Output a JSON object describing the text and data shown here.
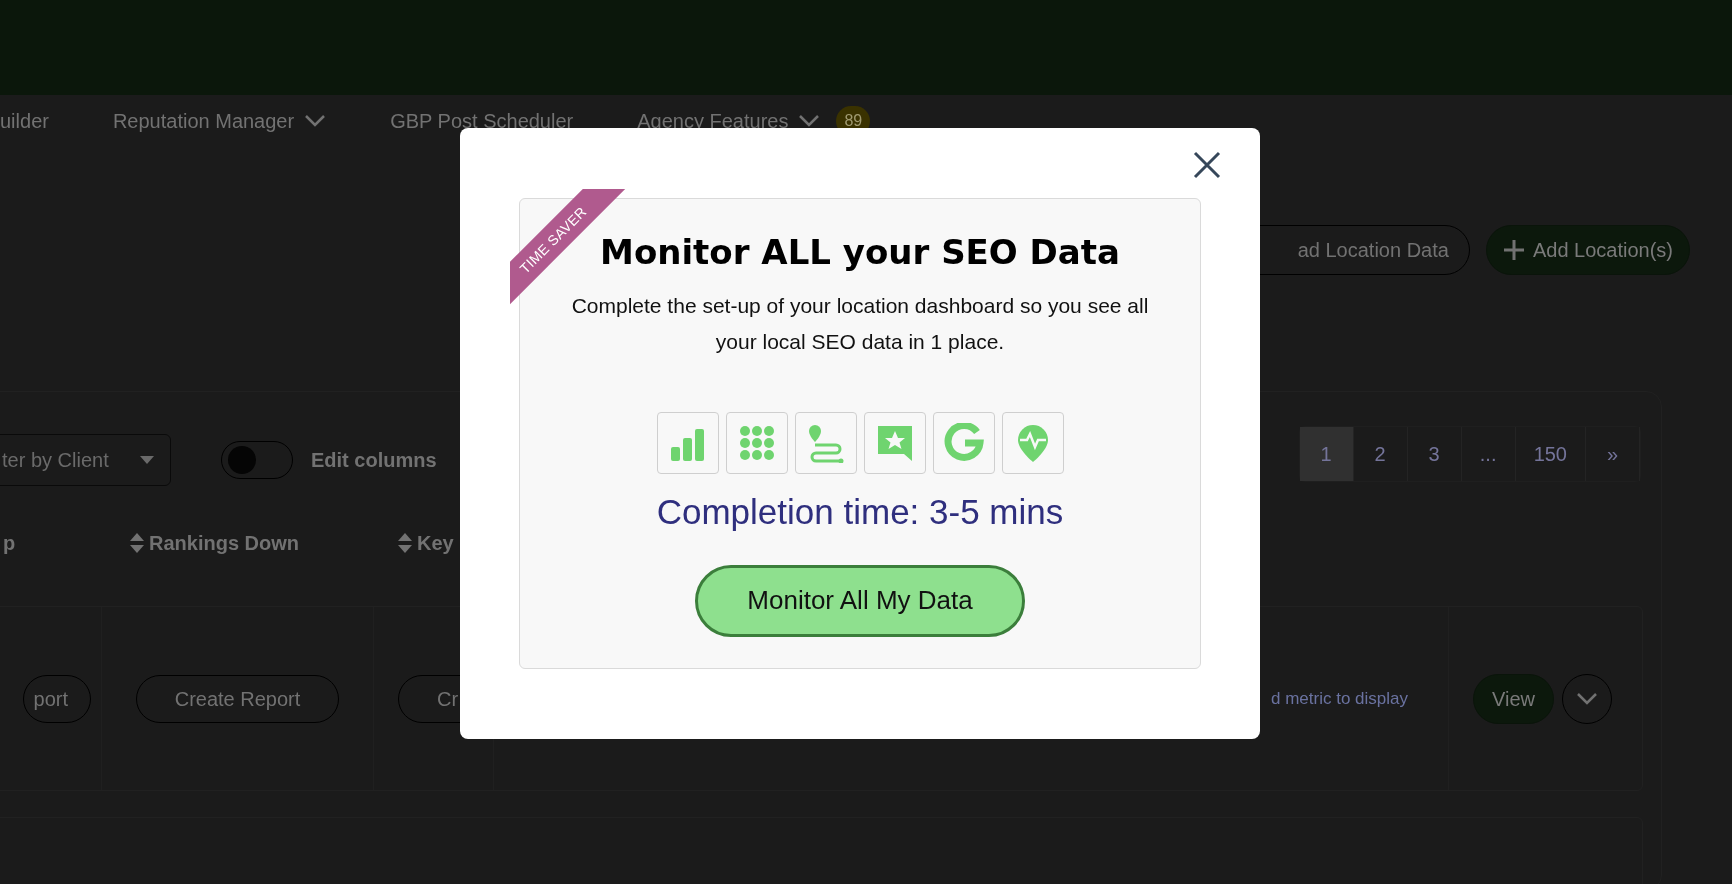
{
  "top_nav": [
    {
      "label": "uilder",
      "has_menu": false
    },
    {
      "label": "Reputation Manager",
      "has_menu": true
    },
    {
      "label": "GBP Post Scheduler",
      "has_menu": false
    },
    {
      "label": "Agency Features",
      "has_menu": true,
      "badge": "89"
    }
  ],
  "header_buttons": [
    {
      "label": "ad Location Data",
      "kind": "outline"
    },
    {
      "label": "Add Location(s)",
      "kind": "add"
    }
  ],
  "filter": {
    "placeholder": "ter by Client"
  },
  "edit_columns": {
    "label": "Edit columns",
    "on": false
  },
  "pagination": [
    {
      "label": "1",
      "selected": true
    },
    {
      "label": "2",
      "selected": false
    },
    {
      "label": "3",
      "selected": false
    },
    {
      "label": "...",
      "selected": false
    },
    {
      "label": "150",
      "selected": false
    },
    {
      "label": "»",
      "selected": false
    }
  ],
  "columns": [
    {
      "label": "p",
      "sortable": false
    },
    {
      "label": "Rankings Down",
      "sortable": true
    },
    {
      "label": "Key",
      "sortable": true
    }
  ],
  "row": {
    "report_buttons": [
      "port",
      "Create Report",
      "Cr"
    ],
    "metric_note": "d metric to display",
    "view": "View"
  },
  "modal": {
    "ribbon": "TIME SAVER",
    "title": "Monitor ALL your SEO Data",
    "description": "Complete the set-up of your location dashboard so you see all your local SEO data in 1 place.",
    "completion": "Completion time: 3-5 mins",
    "cta": "Monitor All My Data"
  }
}
